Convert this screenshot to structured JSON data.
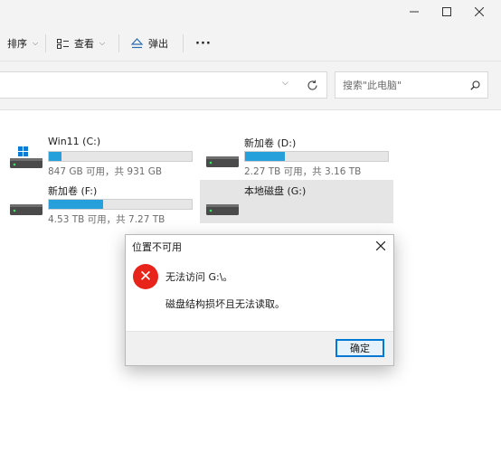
{
  "toolbar": {
    "sort_label": "排序",
    "view_label": "查看",
    "eject_label": "弹出",
    "more_label": "···"
  },
  "address": {
    "search_placeholder": "搜索\"此电脑\""
  },
  "drives": [
    {
      "name": "Win11 (C:)",
      "info": "847 GB 可用，共 931 GB",
      "used_fraction": 0.09
    },
    {
      "name": "新加卷 (D:)",
      "info": "2.27 TB 可用，共 3.16 TB",
      "used_fraction": 0.28
    },
    {
      "name": "新加卷 (F:)",
      "info": "4.53 TB 可用，共 7.27 TB",
      "used_fraction": 0.38
    },
    {
      "name": "本地磁盘 (G:)",
      "info": ""
    }
  ],
  "dialog": {
    "title": "位置不可用",
    "message_main": "无法访问 G:\\。",
    "message_detail": "磁盘结构损坏且无法读取。",
    "ok_label": "确定"
  },
  "colors": {
    "accent": "#26a0da",
    "error": "#e8231a",
    "selection": "#e5e5e5"
  }
}
